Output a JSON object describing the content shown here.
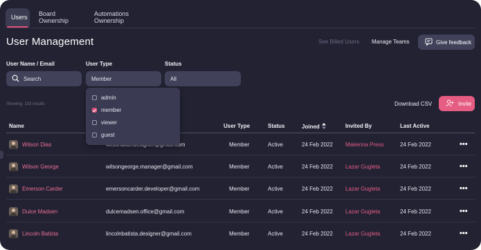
{
  "tabs": [
    {
      "label": "Users",
      "active": true
    },
    {
      "label": "Board Ownership",
      "active": false
    },
    {
      "label": "Automations Ownership",
      "active": false
    }
  ],
  "header": {
    "title": "User Management",
    "see_billed": "See Billed Users",
    "manage_teams": "Manage Teams",
    "give_feedback": "Give feedback"
  },
  "filters": {
    "name_label": "User Name / Email",
    "search_placeholder": "Search",
    "type_label": "User Type",
    "type_value": "Member",
    "status_label": "Status",
    "status_value": "All"
  },
  "type_options": [
    {
      "label": "admin",
      "checked": false
    },
    {
      "label": "member",
      "checked": true
    },
    {
      "label": "viewer",
      "checked": false
    },
    {
      "label": "guest",
      "checked": false
    }
  ],
  "toolbar": {
    "showing": "Showing: 133 results",
    "download": "Download CSV",
    "invite": "Invite"
  },
  "columns": {
    "name": "Name",
    "user_type": "User Type",
    "status": "Status",
    "joined": "Joined",
    "invited_by": "Invited By",
    "last_active": "Last Active"
  },
  "rows": [
    {
      "name": "Wilson Dias",
      "email": "wilsondias.designer@gmail.com",
      "type": "Member",
      "status": "Active",
      "joined": "24 Feb 2022",
      "invited_by": "Makenna Press",
      "last_active": "24 Feb 2022"
    },
    {
      "name": "Wilson George",
      "email": "wilsongeorge.manager@gmail.com",
      "type": "Member",
      "status": "Active",
      "joined": "24 Feb 2022",
      "invited_by": "Lazar Gugleta",
      "last_active": "24 Feb 2022"
    },
    {
      "name": "Emerson Carder",
      "email": "emersoncarder.developer@gmail.com",
      "type": "Member",
      "status": "Active",
      "joined": "24 Feb 2022",
      "invited_by": "Lazar Gugleta",
      "last_active": "24 Feb 2022"
    },
    {
      "name": "Dulce Madsen",
      "email": "dulcemadsen.office@gmail.com",
      "type": "Member",
      "status": "Active",
      "joined": "24 Feb 2022",
      "invited_by": "Lazar Gugleta",
      "last_active": "24 Feb 2022"
    },
    {
      "name": "Lincoln Batista",
      "email": "lincolnbatista.designer@gmail.com",
      "type": "Member",
      "status": "Active",
      "joined": "24 Feb 2022",
      "invited_by": "Lazar Gugleta",
      "last_active": "24 Feb 2022"
    }
  ],
  "icons": {
    "search": "search-icon",
    "feedback": "feedback-icon",
    "invite": "add-user-icon",
    "sort": "sort-icon",
    "more": "more-icon"
  },
  "colors": {
    "background": "#222233",
    "accent": "#e0527a",
    "panel": "#41415a"
  }
}
